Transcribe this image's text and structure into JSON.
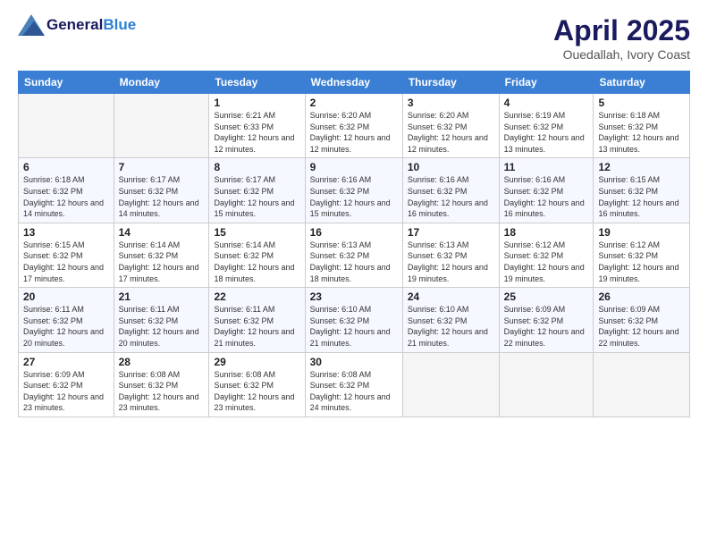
{
  "header": {
    "logo_general": "General",
    "logo_blue": "Blue",
    "title": "April 2025",
    "location": "Ouedallah, Ivory Coast"
  },
  "days_of_week": [
    "Sunday",
    "Monday",
    "Tuesday",
    "Wednesday",
    "Thursday",
    "Friday",
    "Saturday"
  ],
  "weeks": [
    [
      {
        "num": "",
        "sunrise": "",
        "sunset": "",
        "daylight": ""
      },
      {
        "num": "",
        "sunrise": "",
        "sunset": "",
        "daylight": ""
      },
      {
        "num": "1",
        "sunrise": "Sunrise: 6:21 AM",
        "sunset": "Sunset: 6:33 PM",
        "daylight": "Daylight: 12 hours and 12 minutes."
      },
      {
        "num": "2",
        "sunrise": "Sunrise: 6:20 AM",
        "sunset": "Sunset: 6:32 PM",
        "daylight": "Daylight: 12 hours and 12 minutes."
      },
      {
        "num": "3",
        "sunrise": "Sunrise: 6:20 AM",
        "sunset": "Sunset: 6:32 PM",
        "daylight": "Daylight: 12 hours and 12 minutes."
      },
      {
        "num": "4",
        "sunrise": "Sunrise: 6:19 AM",
        "sunset": "Sunset: 6:32 PM",
        "daylight": "Daylight: 12 hours and 13 minutes."
      },
      {
        "num": "5",
        "sunrise": "Sunrise: 6:18 AM",
        "sunset": "Sunset: 6:32 PM",
        "daylight": "Daylight: 12 hours and 13 minutes."
      }
    ],
    [
      {
        "num": "6",
        "sunrise": "Sunrise: 6:18 AM",
        "sunset": "Sunset: 6:32 PM",
        "daylight": "Daylight: 12 hours and 14 minutes."
      },
      {
        "num": "7",
        "sunrise": "Sunrise: 6:17 AM",
        "sunset": "Sunset: 6:32 PM",
        "daylight": "Daylight: 12 hours and 14 minutes."
      },
      {
        "num": "8",
        "sunrise": "Sunrise: 6:17 AM",
        "sunset": "Sunset: 6:32 PM",
        "daylight": "Daylight: 12 hours and 15 minutes."
      },
      {
        "num": "9",
        "sunrise": "Sunrise: 6:16 AM",
        "sunset": "Sunset: 6:32 PM",
        "daylight": "Daylight: 12 hours and 15 minutes."
      },
      {
        "num": "10",
        "sunrise": "Sunrise: 6:16 AM",
        "sunset": "Sunset: 6:32 PM",
        "daylight": "Daylight: 12 hours and 16 minutes."
      },
      {
        "num": "11",
        "sunrise": "Sunrise: 6:16 AM",
        "sunset": "Sunset: 6:32 PM",
        "daylight": "Daylight: 12 hours and 16 minutes."
      },
      {
        "num": "12",
        "sunrise": "Sunrise: 6:15 AM",
        "sunset": "Sunset: 6:32 PM",
        "daylight": "Daylight: 12 hours and 16 minutes."
      }
    ],
    [
      {
        "num": "13",
        "sunrise": "Sunrise: 6:15 AM",
        "sunset": "Sunset: 6:32 PM",
        "daylight": "Daylight: 12 hours and 17 minutes."
      },
      {
        "num": "14",
        "sunrise": "Sunrise: 6:14 AM",
        "sunset": "Sunset: 6:32 PM",
        "daylight": "Daylight: 12 hours and 17 minutes."
      },
      {
        "num": "15",
        "sunrise": "Sunrise: 6:14 AM",
        "sunset": "Sunset: 6:32 PM",
        "daylight": "Daylight: 12 hours and 18 minutes."
      },
      {
        "num": "16",
        "sunrise": "Sunrise: 6:13 AM",
        "sunset": "Sunset: 6:32 PM",
        "daylight": "Daylight: 12 hours and 18 minutes."
      },
      {
        "num": "17",
        "sunrise": "Sunrise: 6:13 AM",
        "sunset": "Sunset: 6:32 PM",
        "daylight": "Daylight: 12 hours and 19 minutes."
      },
      {
        "num": "18",
        "sunrise": "Sunrise: 6:12 AM",
        "sunset": "Sunset: 6:32 PM",
        "daylight": "Daylight: 12 hours and 19 minutes."
      },
      {
        "num": "19",
        "sunrise": "Sunrise: 6:12 AM",
        "sunset": "Sunset: 6:32 PM",
        "daylight": "Daylight: 12 hours and 19 minutes."
      }
    ],
    [
      {
        "num": "20",
        "sunrise": "Sunrise: 6:11 AM",
        "sunset": "Sunset: 6:32 PM",
        "daylight": "Daylight: 12 hours and 20 minutes."
      },
      {
        "num": "21",
        "sunrise": "Sunrise: 6:11 AM",
        "sunset": "Sunset: 6:32 PM",
        "daylight": "Daylight: 12 hours and 20 minutes."
      },
      {
        "num": "22",
        "sunrise": "Sunrise: 6:11 AM",
        "sunset": "Sunset: 6:32 PM",
        "daylight": "Daylight: 12 hours and 21 minutes."
      },
      {
        "num": "23",
        "sunrise": "Sunrise: 6:10 AM",
        "sunset": "Sunset: 6:32 PM",
        "daylight": "Daylight: 12 hours and 21 minutes."
      },
      {
        "num": "24",
        "sunrise": "Sunrise: 6:10 AM",
        "sunset": "Sunset: 6:32 PM",
        "daylight": "Daylight: 12 hours and 21 minutes."
      },
      {
        "num": "25",
        "sunrise": "Sunrise: 6:09 AM",
        "sunset": "Sunset: 6:32 PM",
        "daylight": "Daylight: 12 hours and 22 minutes."
      },
      {
        "num": "26",
        "sunrise": "Sunrise: 6:09 AM",
        "sunset": "Sunset: 6:32 PM",
        "daylight": "Daylight: 12 hours and 22 minutes."
      }
    ],
    [
      {
        "num": "27",
        "sunrise": "Sunrise: 6:09 AM",
        "sunset": "Sunset: 6:32 PM",
        "daylight": "Daylight: 12 hours and 23 minutes."
      },
      {
        "num": "28",
        "sunrise": "Sunrise: 6:08 AM",
        "sunset": "Sunset: 6:32 PM",
        "daylight": "Daylight: 12 hours and 23 minutes."
      },
      {
        "num": "29",
        "sunrise": "Sunrise: 6:08 AM",
        "sunset": "Sunset: 6:32 PM",
        "daylight": "Daylight: 12 hours and 23 minutes."
      },
      {
        "num": "30",
        "sunrise": "Sunrise: 6:08 AM",
        "sunset": "Sunset: 6:32 PM",
        "daylight": "Daylight: 12 hours and 24 minutes."
      },
      {
        "num": "",
        "sunrise": "",
        "sunset": "",
        "daylight": ""
      },
      {
        "num": "",
        "sunrise": "",
        "sunset": "",
        "daylight": ""
      },
      {
        "num": "",
        "sunrise": "",
        "sunset": "",
        "daylight": ""
      }
    ]
  ]
}
